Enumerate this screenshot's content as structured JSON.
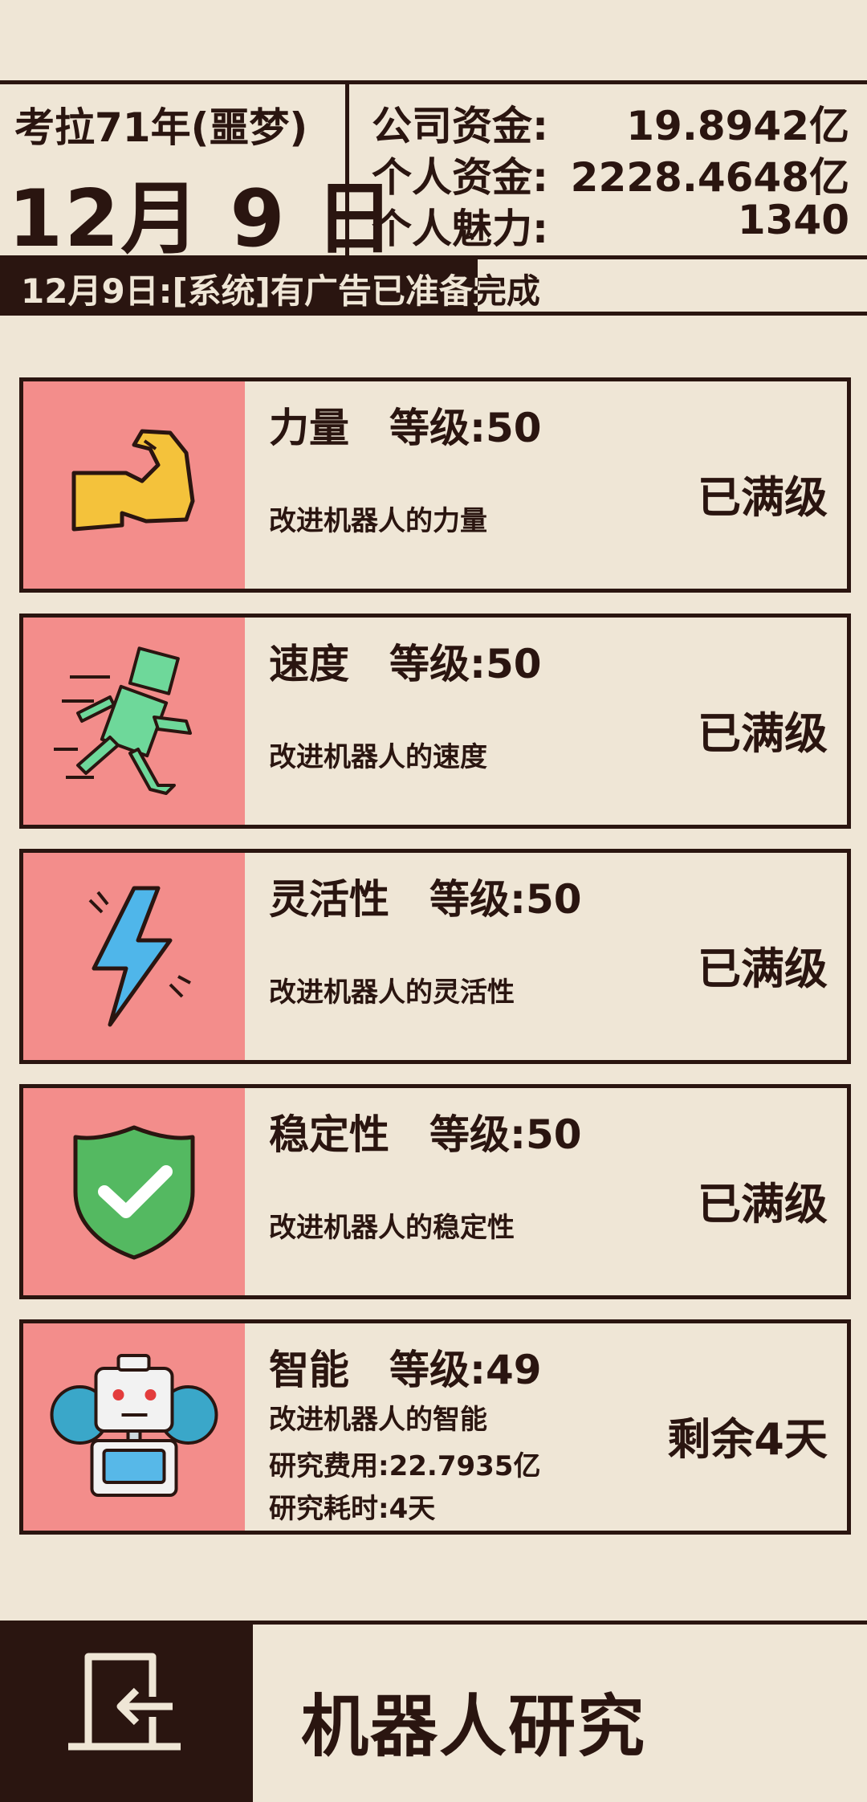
{
  "header": {
    "era": "考拉71年(噩梦)",
    "day": "12月 9 日",
    "funds": [
      {
        "label": "公司资金:",
        "value": "19.8942亿"
      },
      {
        "label": "个人资金:",
        "value": "2228.4648亿"
      },
      {
        "label": "个人魅力:",
        "value": "1340"
      }
    ]
  },
  "ticker": {
    "text": "12月9日:[系统]有广告已准备完成"
  },
  "research": [
    {
      "icon": "flexed-arm-icon",
      "name": "力量",
      "level": "等级:50",
      "desc": "改进机器人的力量",
      "status": "已满级"
    },
    {
      "icon": "running-robot-icon",
      "name": "速度",
      "level": "等级:50",
      "desc": "改进机器人的速度",
      "status": "已满级"
    },
    {
      "icon": "lightning-icon",
      "name": "灵活性",
      "level": "等级:50",
      "desc": "改进机器人的灵活性",
      "status": "已满级"
    },
    {
      "icon": "shield-check-icon",
      "name": "稳定性",
      "level": "等级:50",
      "desc": "改进机器人的稳定性",
      "status": "已满级"
    },
    {
      "icon": "robot-gear-icon",
      "name": "智能",
      "level": "等级:49",
      "desc": "改进机器人的智能",
      "cost": "研究费用:22.7935亿",
      "time": "研究耗时:4天",
      "status": "剩余4天"
    }
  ],
  "footer": {
    "title": "机器人研究",
    "exit_icon": "exit-door-icon"
  },
  "colors": {
    "background": "#efe6d6",
    "dark": "#2a1510",
    "thumb": "#f38d8b"
  }
}
